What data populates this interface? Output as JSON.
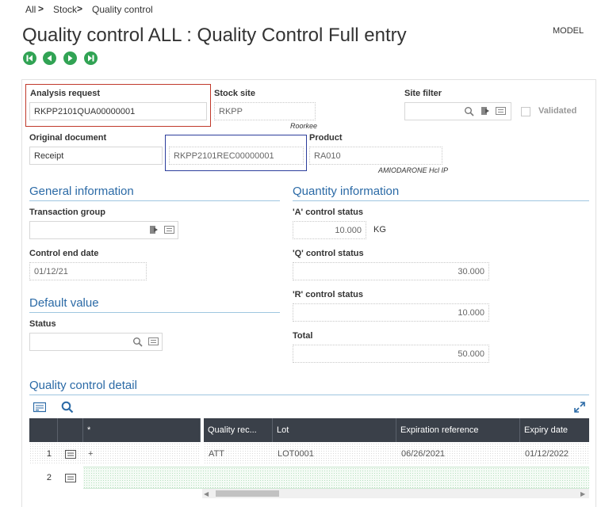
{
  "breadcrumb": {
    "items": [
      "All",
      "Stock",
      "Quality control"
    ],
    "separator": ">"
  },
  "page": {
    "title": "Quality control ALL : Quality Control Full entry",
    "mode": "MODEL"
  },
  "nav_buttons": [
    "first-record-icon",
    "previous-record-icon",
    "next-record-icon",
    "last-record-icon"
  ],
  "header": {
    "analysis_request": {
      "label": "Analysis request",
      "value": "RKPP2101QUA00000001"
    },
    "stock_site": {
      "label": "Stock site",
      "value": "RKPP",
      "description": "Roorkee"
    },
    "site_filter": {
      "label": "Site filter",
      "value": ""
    },
    "validated": {
      "label": "Validated",
      "checked": false
    },
    "original_document": {
      "label": "Original document",
      "value": "Receipt",
      "document_number": "RKPP2101REC00000001"
    },
    "product": {
      "label": "Product",
      "value": "RA010",
      "description": "AMIODARONE Hcl IP"
    }
  },
  "general_information": {
    "title": "General information",
    "transaction_group": {
      "label": "Transaction group",
      "value": ""
    },
    "control_end_date": {
      "label": "Control end date",
      "value": "01/12/21"
    }
  },
  "default_value": {
    "title": "Default value",
    "status": {
      "label": "Status",
      "value": ""
    }
  },
  "quantity_information": {
    "title": "Quantity information",
    "a_status": {
      "label": "'A' control status",
      "value": "10.000",
      "unit": "KG"
    },
    "q_status": {
      "label": "'Q' control status",
      "value": "30.000"
    },
    "r_status": {
      "label": "'R' control status",
      "value": "10.000"
    },
    "total": {
      "label": "Total",
      "value": "50.000"
    }
  },
  "detail": {
    "title": "Quality control detail",
    "columns": [
      "*",
      "Quality rec...",
      "Lot",
      "Expiration reference",
      "Expiry date"
    ],
    "rows": [
      {
        "num": "1",
        "star": "+",
        "quality_rec": "ATT",
        "lot": "LOT0001",
        "expiration_reference": "06/26/2021",
        "expiry_date": "01/12/2022"
      },
      {
        "num": "2",
        "star": "",
        "quality_rec": "",
        "lot": "",
        "expiration_reference": "",
        "expiry_date": ""
      }
    ]
  },
  "colors": {
    "accent": "#2b6aa6",
    "nav_green": "#31a354",
    "header_dark": "#3a4049",
    "highlight_red": "#c0392b",
    "highlight_blue": "#2c3e9c"
  }
}
